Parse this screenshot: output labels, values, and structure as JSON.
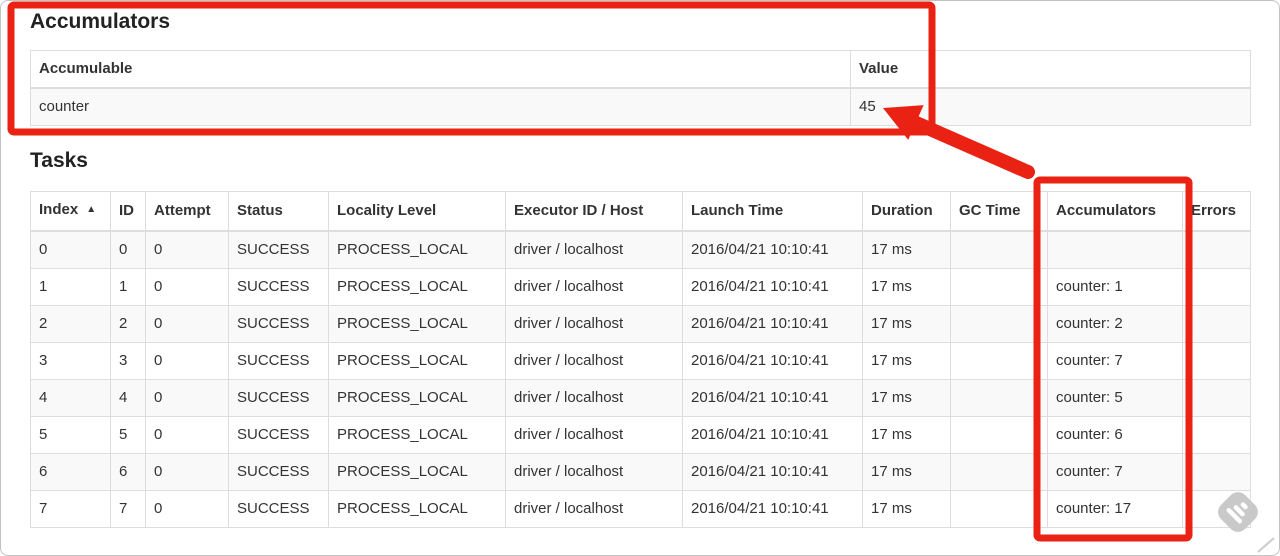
{
  "accumulators": {
    "title": "Accumulators",
    "table": {
      "headers": [
        "Accumulable",
        "Value"
      ],
      "rows": [
        [
          "counter",
          "45"
        ]
      ]
    }
  },
  "tasks": {
    "title": "Tasks",
    "table": {
      "headers": [
        "Index",
        "ID",
        "Attempt",
        "Status",
        "Locality Level",
        "Executor ID / Host",
        "Launch Time",
        "Duration",
        "GC Time",
        "Accumulators",
        "Errors"
      ],
      "sort_icon": "▲",
      "rows": [
        {
          "index": "0",
          "id": "0",
          "attempt": "0",
          "status": "SUCCESS",
          "locality": "PROCESS_LOCAL",
          "executor": "driver / localhost",
          "launch": "2016/04/21 10:10:41",
          "duration": "17 ms",
          "gc_time": "",
          "accumulators": "",
          "errors": ""
        },
        {
          "index": "1",
          "id": "1",
          "attempt": "0",
          "status": "SUCCESS",
          "locality": "PROCESS_LOCAL",
          "executor": "driver / localhost",
          "launch": "2016/04/21 10:10:41",
          "duration": "17 ms",
          "gc_time": "",
          "accumulators": "counter: 1",
          "errors": ""
        },
        {
          "index": "2",
          "id": "2",
          "attempt": "0",
          "status": "SUCCESS",
          "locality": "PROCESS_LOCAL",
          "executor": "driver / localhost",
          "launch": "2016/04/21 10:10:41",
          "duration": "17 ms",
          "gc_time": "",
          "accumulators": "counter: 2",
          "errors": ""
        },
        {
          "index": "3",
          "id": "3",
          "attempt": "0",
          "status": "SUCCESS",
          "locality": "PROCESS_LOCAL",
          "executor": "driver / localhost",
          "launch": "2016/04/21 10:10:41",
          "duration": "17 ms",
          "gc_time": "",
          "accumulators": "counter: 7",
          "errors": ""
        },
        {
          "index": "4",
          "id": "4",
          "attempt": "0",
          "status": "SUCCESS",
          "locality": "PROCESS_LOCAL",
          "executor": "driver / localhost",
          "launch": "2016/04/21 10:10:41",
          "duration": "17 ms",
          "gc_time": "",
          "accumulators": "counter: 5",
          "errors": ""
        },
        {
          "index": "5",
          "id": "5",
          "attempt": "0",
          "status": "SUCCESS",
          "locality": "PROCESS_LOCAL",
          "executor": "driver / localhost",
          "launch": "2016/04/21 10:10:41",
          "duration": "17 ms",
          "gc_time": "",
          "accumulators": "counter: 6",
          "errors": ""
        },
        {
          "index": "6",
          "id": "6",
          "attempt": "0",
          "status": "SUCCESS",
          "locality": "PROCESS_LOCAL",
          "executor": "driver / localhost",
          "launch": "2016/04/21 10:10:41",
          "duration": "17 ms",
          "gc_time": "",
          "accumulators": "counter: 7",
          "errors": ""
        },
        {
          "index": "7",
          "id": "7",
          "attempt": "0",
          "status": "SUCCESS",
          "locality": "PROCESS_LOCAL",
          "executor": "driver / localhost",
          "launch": "2016/04/21 10:10:41",
          "duration": "17 ms",
          "gc_time": "",
          "accumulators": "counter: 17",
          "errors": ""
        }
      ]
    }
  },
  "colors": {
    "annotation_red": "#ea2213",
    "table_border": "#dddddd",
    "row_stripe": "#f9f9f9",
    "text": "#333333",
    "watermark_gray": "#c9c9c9"
  }
}
